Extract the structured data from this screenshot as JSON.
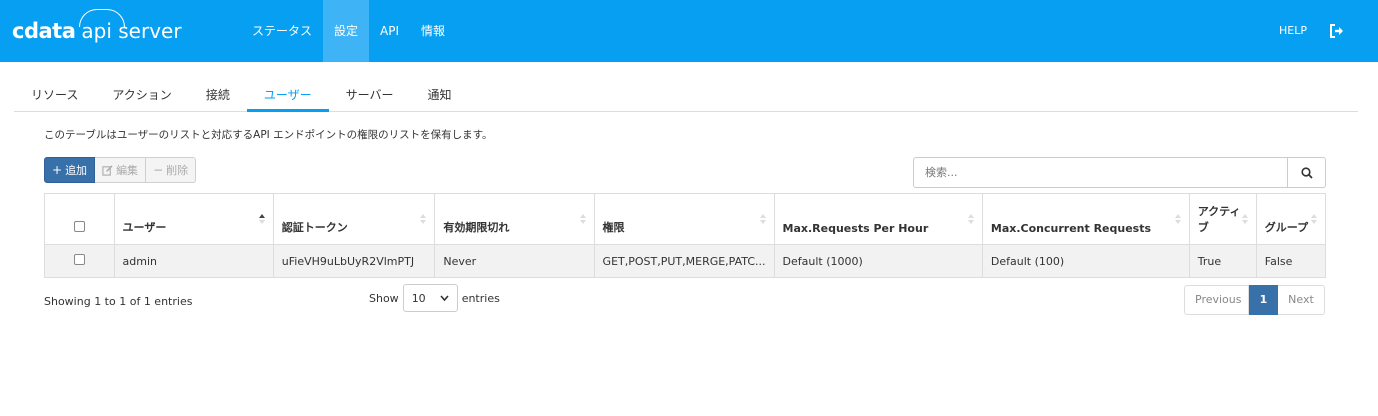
{
  "header": {
    "logo": {
      "brand": "cdata",
      "product": "api server"
    },
    "nav": [
      "ステータス",
      "設定",
      "API",
      "情報"
    ],
    "active_nav": "設定",
    "help": "HELP",
    "logout_icon": "sign-out-icon"
  },
  "tabs": [
    "リソース",
    "アクション",
    "接続",
    "ユーザー",
    "サーバー",
    "通知"
  ],
  "active_tab": "ユーザー",
  "description": "このテーブルはユーザーのリストと対応するAPI エンドポイントの権限のリストを保有します。",
  "toolbar": {
    "add": "追加",
    "edit": "編集",
    "delete": "削除"
  },
  "search": {
    "placeholder": "検索..."
  },
  "table": {
    "columns": [
      "ユーザー",
      "認証トークン",
      "有効期限切れ",
      "権限",
      "Max.Requests Per Hour",
      "Max.Concurrent Requests",
      "アクティブ",
      "グループ"
    ],
    "rows": [
      [
        "admin",
        "uFieVH9uLbUyR2VlmPTJ",
        "Never",
        "GET,POST,PUT,MERGE,PATC...",
        "Default (1000)",
        "Default (100)",
        "True",
        "False"
      ]
    ]
  },
  "info": "Showing 1 to 1 of 1 entries",
  "length": {
    "prefix": "Show",
    "value": "10",
    "suffix": "entries"
  },
  "pager": {
    "previous": "Previous",
    "current": "1",
    "next": "Next"
  },
  "colors": {
    "header": "#069ff1",
    "primary": "#3870a9"
  }
}
